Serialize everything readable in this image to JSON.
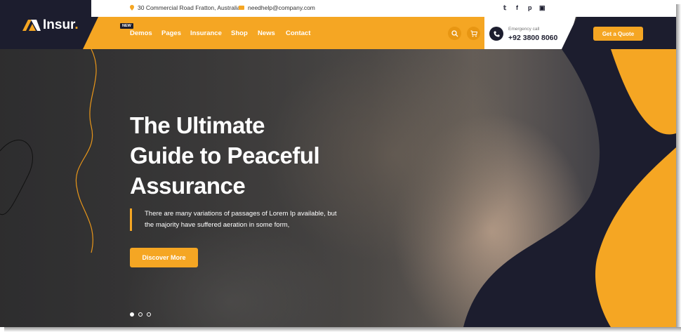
{
  "brand": {
    "name": "Insur",
    "dot": "."
  },
  "topbar": {
    "address": "30 Commercial Road Fratton, Australia",
    "email": "needhelp@company.com",
    "social": [
      "twitter-icon",
      "facebook-icon",
      "pinterest-icon",
      "instagram-icon"
    ]
  },
  "nav": {
    "badge": "NEW",
    "items": [
      "Demos",
      "Pages",
      "Insurance",
      "Shop",
      "News",
      "Contact"
    ]
  },
  "contact": {
    "label": "Emergency call",
    "phone": "+92 3800 8060"
  },
  "cta": {
    "quote": "Get a Quote"
  },
  "hero": {
    "title_line1": "The Ultimate",
    "title_line2": "Guide to Peaceful",
    "title_line3": "Assurance",
    "desc_line1": "There are many variations of passages of Lorem Ip available, but",
    "desc_line2": "the majority have suffered aeration in some form,",
    "button": "Discover More"
  },
  "slider": {
    "count": 3,
    "active": 1
  },
  "colors": {
    "accent": "#f5a623",
    "dark": "#1c1d2e",
    "white": "#ffffff"
  }
}
